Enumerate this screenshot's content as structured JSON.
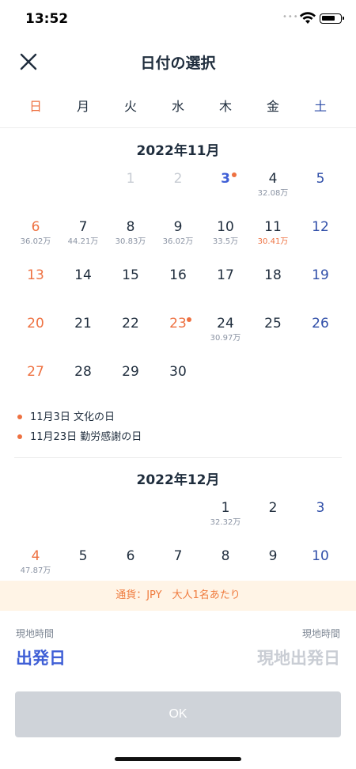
{
  "status": {
    "time": "13:52"
  },
  "nav": {
    "title": "日付の選択"
  },
  "weekdays": [
    "日",
    "月",
    "火",
    "水",
    "木",
    "金",
    "土"
  ],
  "months": [
    {
      "title": "2022年11月",
      "days": [
        {
          "d": "1",
          "price": "",
          "state": "disabled"
        },
        {
          "d": "2",
          "price": "",
          "state": "disabled"
        },
        {
          "d": "3",
          "price": "",
          "state": "today",
          "holiday": true
        },
        {
          "d": "4",
          "price": "32.08万",
          "state": "normal"
        },
        {
          "d": "5",
          "price": "",
          "state": "normal"
        },
        {
          "d": "6",
          "price": "36.02万",
          "state": "normal"
        },
        {
          "d": "7",
          "price": "44.21万",
          "state": "normal"
        },
        {
          "d": "8",
          "price": "30.83万",
          "state": "normal"
        },
        {
          "d": "9",
          "price": "36.02万",
          "state": "normal"
        },
        {
          "d": "10",
          "price": "33.5万",
          "state": "normal"
        },
        {
          "d": "11",
          "price": "30.41万",
          "state": "normal",
          "lowest": true
        },
        {
          "d": "12",
          "price": "",
          "state": "normal"
        },
        {
          "d": "13",
          "price": "",
          "state": "normal"
        },
        {
          "d": "14",
          "price": "",
          "state": "normal"
        },
        {
          "d": "15",
          "price": "",
          "state": "normal"
        },
        {
          "d": "16",
          "price": "",
          "state": "normal"
        },
        {
          "d": "17",
          "price": "",
          "state": "normal"
        },
        {
          "d": "18",
          "price": "",
          "state": "normal"
        },
        {
          "d": "19",
          "price": "",
          "state": "normal"
        },
        {
          "d": "20",
          "price": "",
          "state": "normal"
        },
        {
          "d": "21",
          "price": "",
          "state": "normal"
        },
        {
          "d": "22",
          "price": "",
          "state": "normal"
        },
        {
          "d": "23",
          "price": "",
          "state": "normal",
          "holiday": true
        },
        {
          "d": "24",
          "price": "30.97万",
          "state": "normal"
        },
        {
          "d": "25",
          "price": "",
          "state": "normal"
        },
        {
          "d": "26",
          "price": "",
          "state": "normal"
        },
        {
          "d": "27",
          "price": "",
          "state": "normal"
        },
        {
          "d": "28",
          "price": "",
          "state": "normal"
        },
        {
          "d": "29",
          "price": "",
          "state": "normal"
        },
        {
          "d": "30",
          "price": "",
          "state": "normal"
        }
      ],
      "holidays": [
        "11月3日 文化の日",
        "11月23日 勤労感謝の日"
      ]
    },
    {
      "title": "2022年12月",
      "days": [
        {
          "d": "1",
          "price": "32.32万",
          "state": "normal"
        },
        {
          "d": "2",
          "price": "",
          "state": "normal"
        },
        {
          "d": "3",
          "price": "",
          "state": "normal"
        },
        {
          "d": "4",
          "price": "47.87万",
          "state": "normal"
        },
        {
          "d": "5",
          "price": "",
          "state": "normal"
        },
        {
          "d": "6",
          "price": "",
          "state": "normal"
        },
        {
          "d": "7",
          "price": "",
          "state": "normal"
        },
        {
          "d": "8",
          "price": "",
          "state": "normal"
        },
        {
          "d": "9",
          "price": "",
          "state": "normal"
        },
        {
          "d": "10",
          "price": "",
          "state": "normal"
        }
      ]
    }
  ],
  "banner": {
    "text": "通貨：JPY　大人1名あたり"
  },
  "footer": {
    "left_label": "現地時間",
    "right_label": "現地時間",
    "departure": "出発日",
    "return": "現地出発日",
    "ok": "OK"
  },
  "colors": {
    "accent_blue": "#3f5fd6",
    "sunday_orange": "#ee7141",
    "saturday_blue": "#2f4ea8",
    "banner_bg": "#fff4e6",
    "button_disabled": "#cfd3d9"
  }
}
